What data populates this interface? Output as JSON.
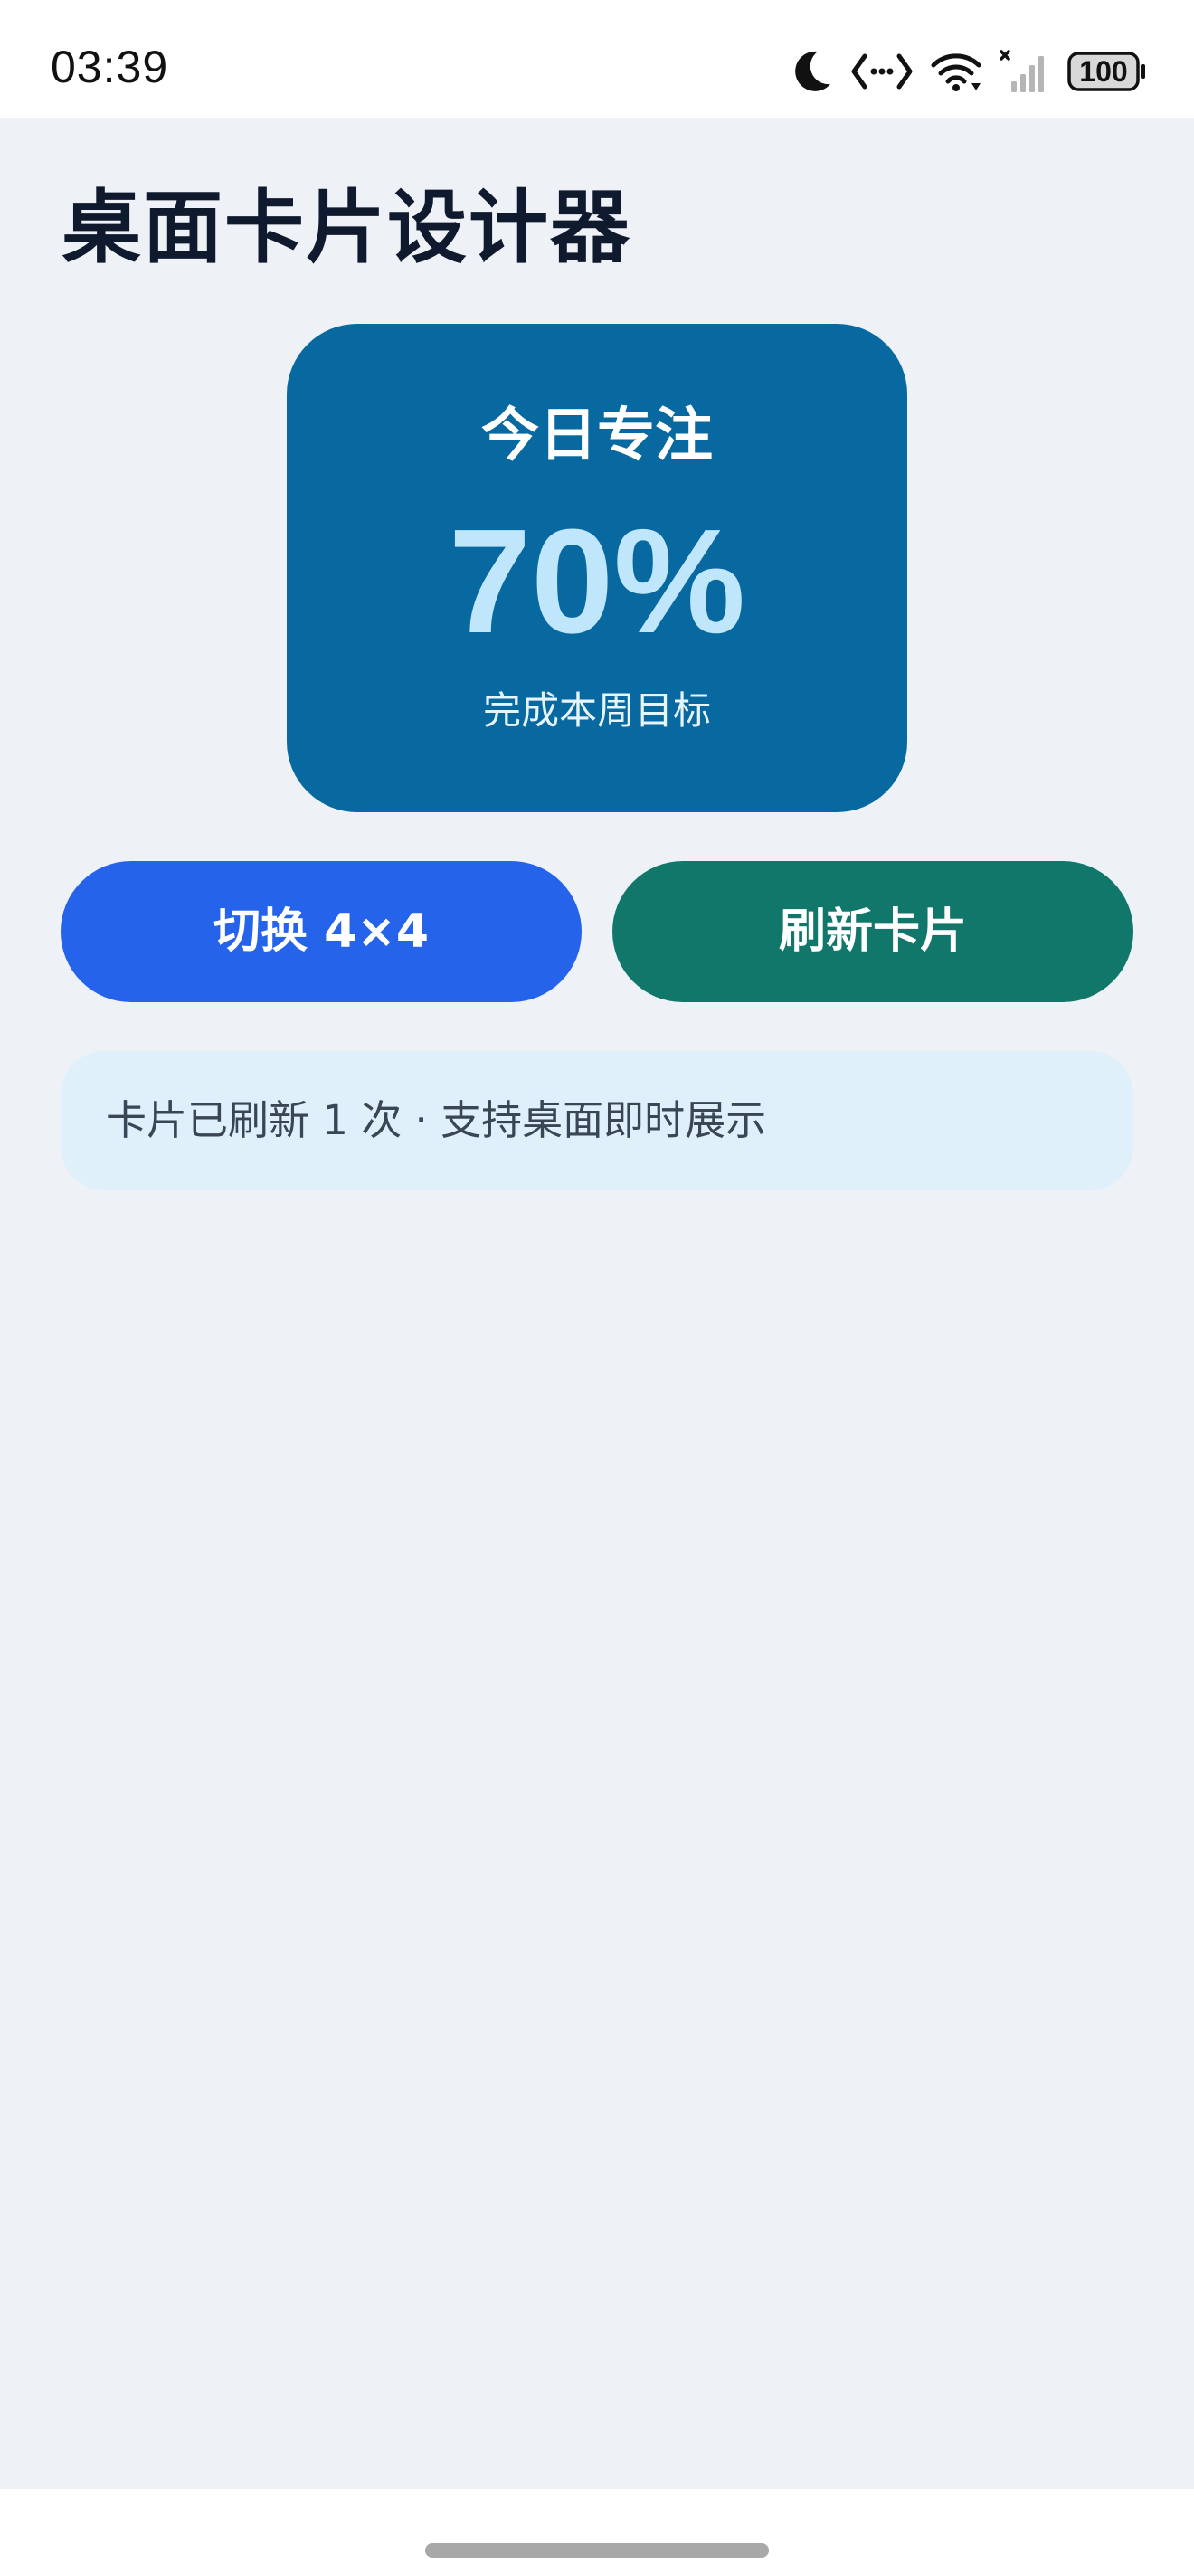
{
  "status_bar": {
    "time": "03:39",
    "battery": "100",
    "icons": [
      "moon-icon",
      "code-icon",
      "wifi-icon",
      "signal-off-icon",
      "battery-icon"
    ]
  },
  "page": {
    "title": "桌面卡片设计器"
  },
  "widget": {
    "title": "今日专注",
    "value": "70%",
    "caption": "完成本周目标",
    "background_color": "#07699f",
    "value_color": "#bfe6fb"
  },
  "actions": {
    "switch_label": "切换 4×4",
    "switch_color": "#2563eb",
    "refresh_label": "刷新卡片",
    "refresh_color": "#12776b"
  },
  "info": {
    "text": "卡片已刷新 1 次 · 支持桌面即时展示"
  }
}
